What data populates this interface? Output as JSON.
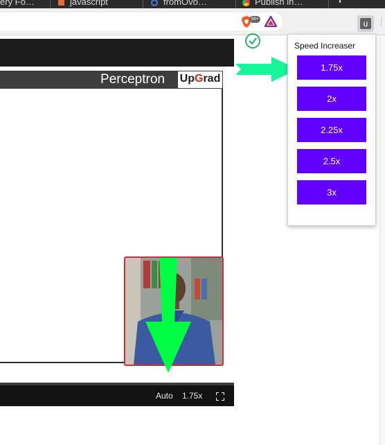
{
  "tabs": [
    {
      "label": "ery Fo…",
      "favicon": "tab-generic-icon"
    },
    {
      "label": "javascript",
      "favicon": "document-icon"
    },
    {
      "label": "fromOvo…",
      "favicon": "globe-icon"
    },
    {
      "label": "Publish in…",
      "favicon": "chrome-web-store-icon"
    }
  ],
  "toolbar": {
    "brave_badge": "99+",
    "extension_button_label": "u"
  },
  "slide": {
    "title": "Perceptron",
    "logo_prefix": "Up",
    "logo_accent": "G",
    "logo_suffix": "rad"
  },
  "player": {
    "quality_label": "Auto",
    "speed_label": "1.75x"
  },
  "popup": {
    "title": "Speed Increaser",
    "options": [
      "1.75x",
      "2x",
      "2.25x",
      "2.5x",
      "3x"
    ]
  },
  "colors": {
    "button": "#6200ff",
    "annotation_arrow_right": "#16f59a",
    "annotation_arrow_down": "#00ff44",
    "checkmark": "#27b36a"
  }
}
